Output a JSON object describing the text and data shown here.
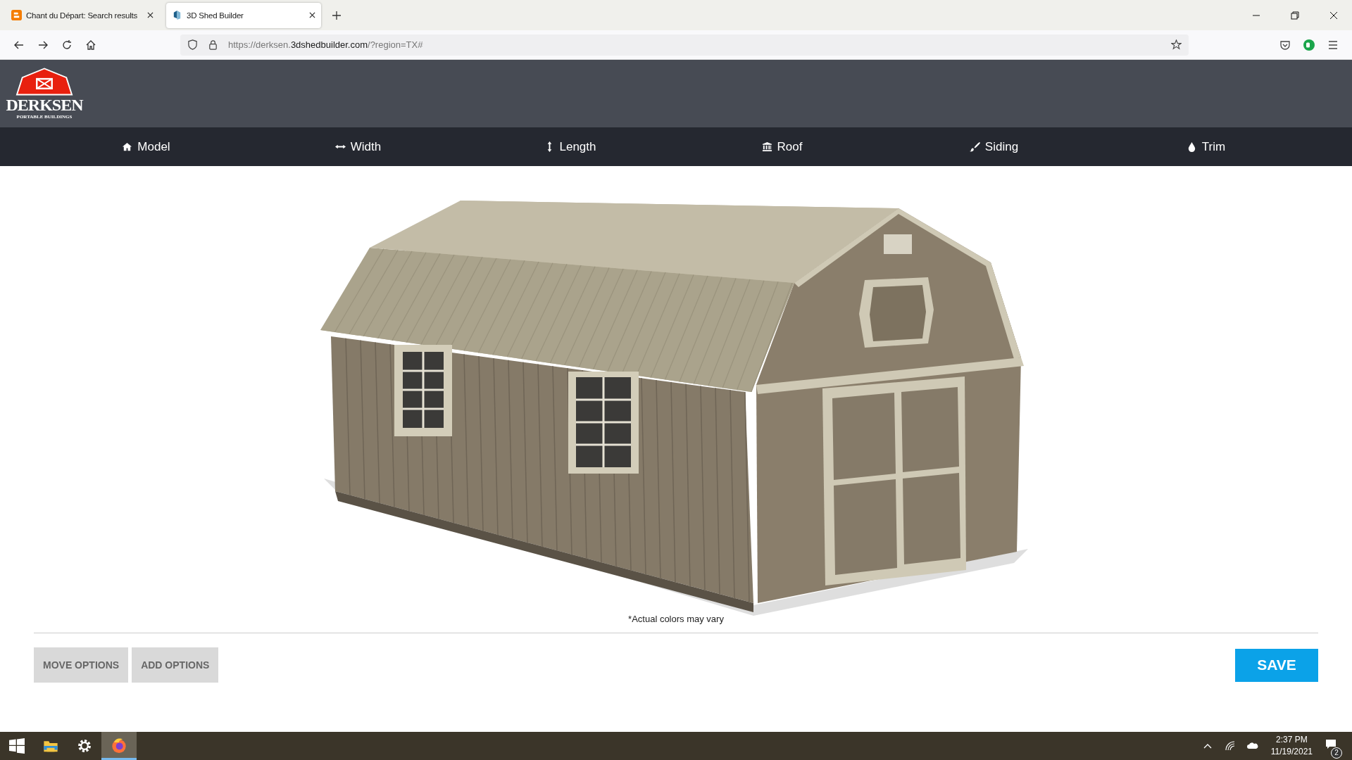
{
  "browser": {
    "tabs": [
      {
        "title": "Chant du Départ: Search results",
        "selected": false
      },
      {
        "title": "3D Shed Builder",
        "selected": true
      }
    ],
    "url": {
      "prefix": "https://derksen.",
      "host": "3dshedbuilder.com",
      "suffix": "/?region=TX#"
    }
  },
  "site": {
    "logo": {
      "name": "DERKSEN",
      "tagline": "PORTABLE BUILDINGS"
    },
    "nav": [
      {
        "label": "Model"
      },
      {
        "label": "Width"
      },
      {
        "label": "Length"
      },
      {
        "label": "Roof"
      },
      {
        "label": "Siding"
      },
      {
        "label": "Trim"
      }
    ],
    "caption": "*Actual colors may vary",
    "buttons": [
      "MOVE OPTIONS",
      "ADD OPTIONS"
    ],
    "save": "SAVE"
  },
  "taskbar": {
    "apps": [
      {
        "kind": "start",
        "selected": false
      },
      {
        "kind": "files",
        "selected": false
      },
      {
        "kind": "settings",
        "selected": false
      },
      {
        "kind": "firefox",
        "selected": true
      }
    ],
    "time": "2:37 PM",
    "date": "11/19/2021",
    "notifications": "2"
  }
}
